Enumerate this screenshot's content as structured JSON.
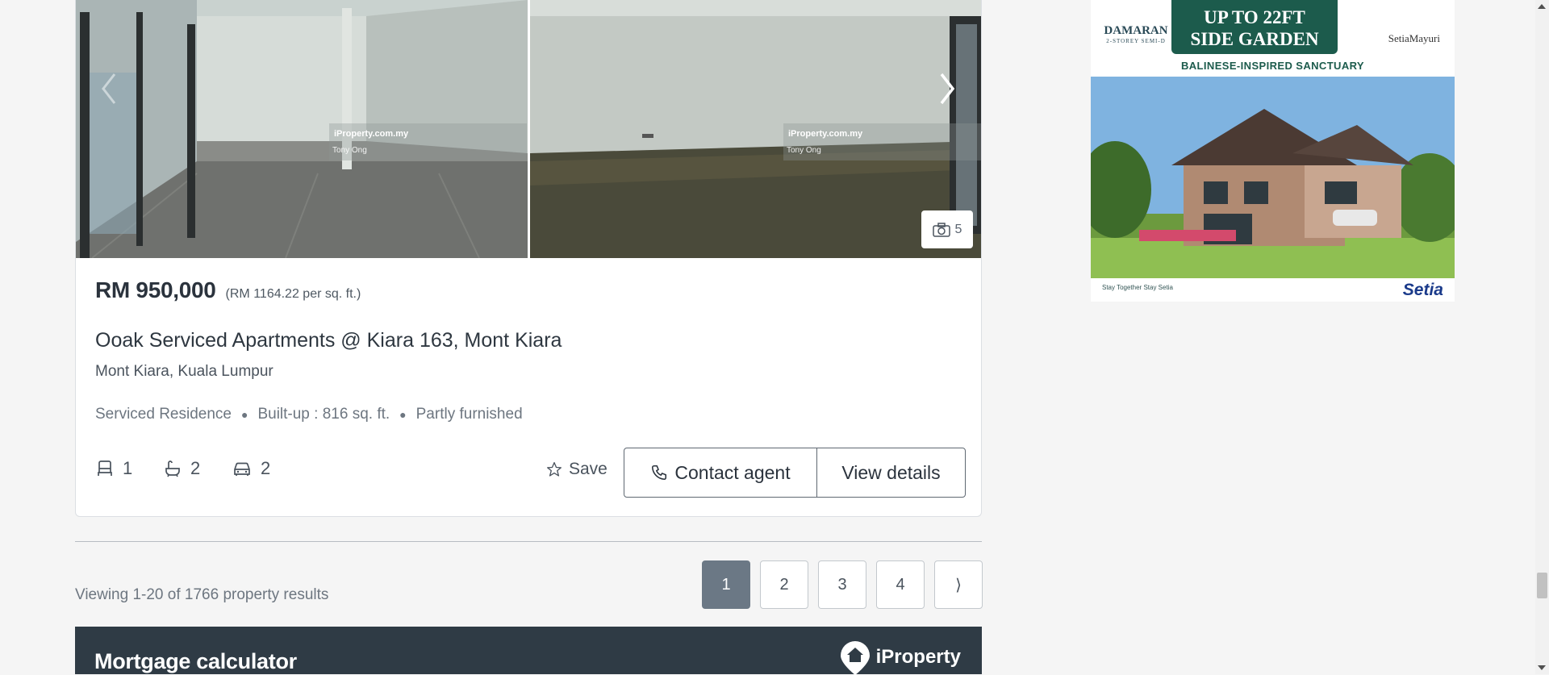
{
  "listing": {
    "photo_watermark_brand": "iProperty.com.my",
    "photo_watermark_agent": "Tony Ong",
    "photo_count": "5",
    "price": "RM 950,000",
    "price_per_sqft": "(RM 1164.22 per sq. ft.)",
    "title": "Ooak Serviced Apartments @ Kiara 163, Mont Kiara",
    "location": "Mont Kiara, Kuala Lumpur",
    "attributes": [
      "Serviced Residence",
      "Built-up : 816 sq. ft.",
      "Partly furnished"
    ],
    "bedrooms": "1",
    "bathrooms": "2",
    "parking": "2",
    "save_label": "Save",
    "contact_label": "Contact agent",
    "details_label": "View details"
  },
  "pagination": {
    "results_text": "Viewing 1-20 of 1766 property results",
    "pages": [
      "1",
      "2",
      "3",
      "4"
    ],
    "current_page": "1",
    "next_label": "⟩"
  },
  "mortgage": {
    "title": "Mortgage calculator",
    "logo_text": "iProperty"
  },
  "ad": {
    "brand": "DAMARAN",
    "brand_sub": "2-STOREY SEMI-D",
    "headline_1": "UP TO 22FT",
    "headline_2": "SIDE GARDEN",
    "tagline": "BALINESE-INSPIRED SANCTUARY",
    "developer_project": "SetiaMayuri",
    "footer_slogan": "Stay Together Stay Setia",
    "footer_brand": "Setia"
  },
  "colors": {
    "page_bg": "#f5f5f5",
    "active_page": "#6b7885",
    "mortgage_bar": "#2f3b45",
    "ad_green": "#1c5b4c"
  }
}
